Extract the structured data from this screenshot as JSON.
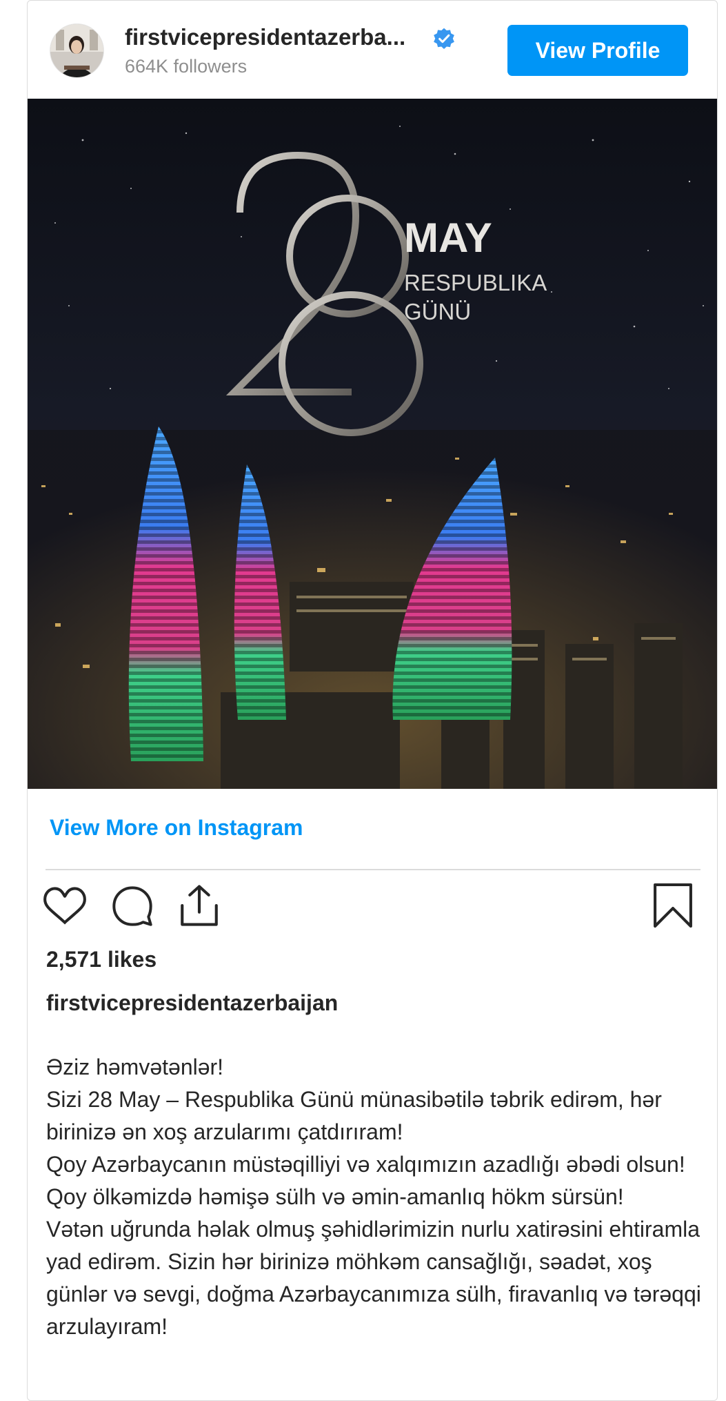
{
  "post": {
    "username": "firstvicepresidentazerba...",
    "followers": "664K followers",
    "view_profile_label": "View Profile",
    "image_text": {
      "number": "28",
      "month": "MAY",
      "line1": "RESPUBLIKA",
      "line2": "GÜNÜ"
    },
    "view_more_label": "View More on Instagram",
    "likes": "2,571 likes",
    "owner": "firstvicepresidentazerbaijan",
    "caption": "Əziz həmvətənlər!\nSizi 28 May – Respublika Günü münasibətilə təbrik edirəm, hər birinizə ən xoş arzularımı çatdırıram!\nQoy Azərbaycanın müstəqilliyi və xalqımızın azadlığı əbədi olsun! Qoy ölkəmizdə həmişə sülh və əmin-amanlıq hökm sürsün!\nVətən uğrunda həlak olmuş şəhidlərimizin nurlu xatirəsini ehtiramla yad edirəm. Sizin hər birinizə möhkəm cansağlığı, səadət, xoş günlər və sevgi, doğma Azərbaycanımıza sülh, firavanlıq və tərəqqi arzulayıram!"
  },
  "icons": {
    "verified": "verified-badge-icon",
    "like": "heart-icon",
    "comment": "comment-icon",
    "share": "share-icon",
    "save": "bookmark-icon"
  },
  "colors": {
    "accent": "#0095f6",
    "text": "#262626",
    "muted": "#8e8e8e"
  }
}
